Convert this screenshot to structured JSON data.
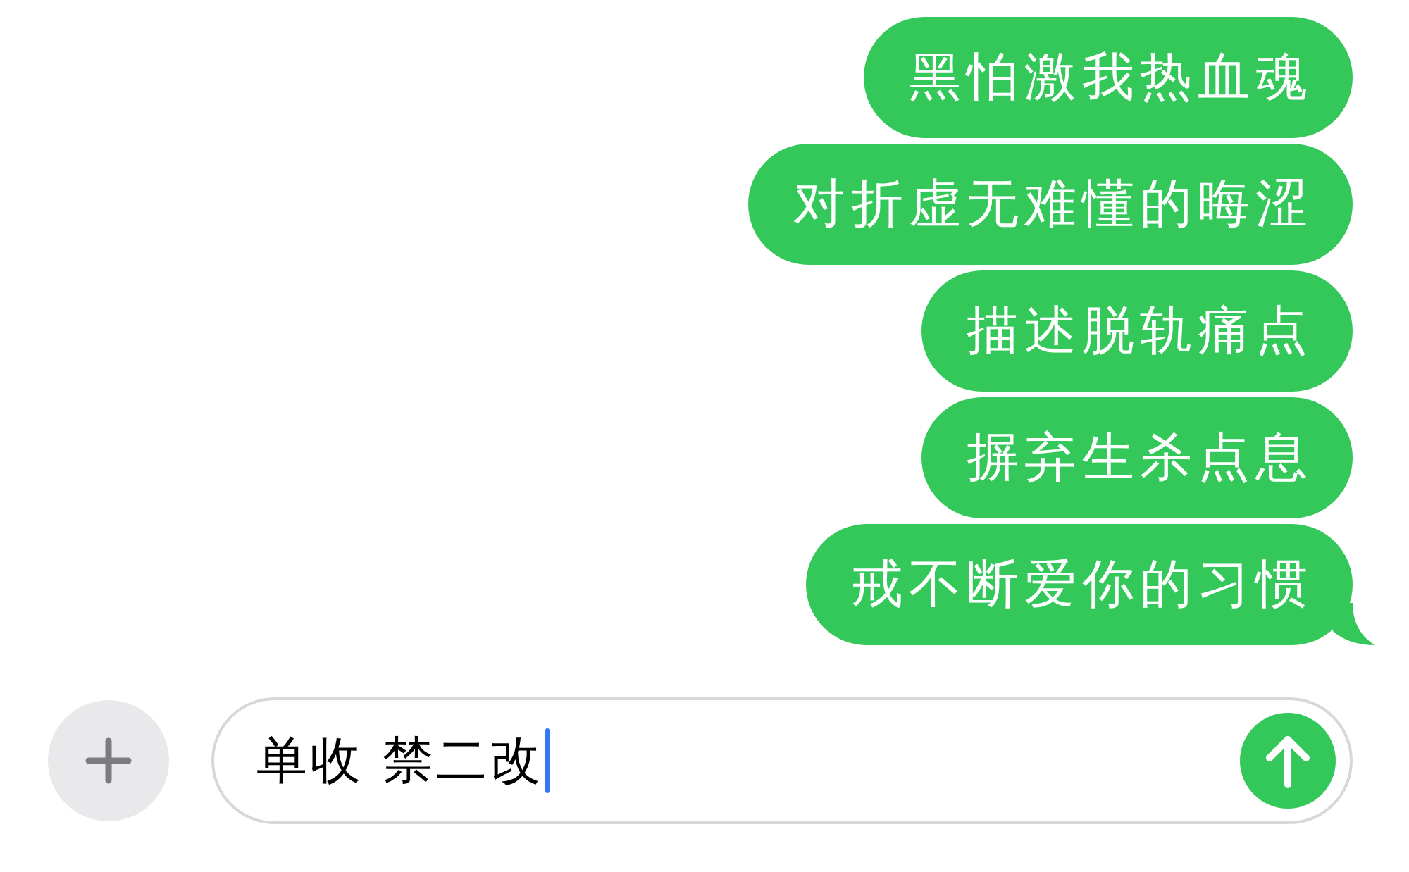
{
  "messages": [
    {
      "text": "黑怕激我热血魂",
      "tail": false
    },
    {
      "text": "对折虚无难懂的晦涩",
      "tail": false
    },
    {
      "text": "描述脱轨痛点",
      "tail": false
    },
    {
      "text": "摒弃生杀点息",
      "tail": false
    },
    {
      "text": "戒不断爱你的习惯",
      "tail": true
    }
  ],
  "composer": {
    "value": "单收 禁二改",
    "focused": true
  }
}
